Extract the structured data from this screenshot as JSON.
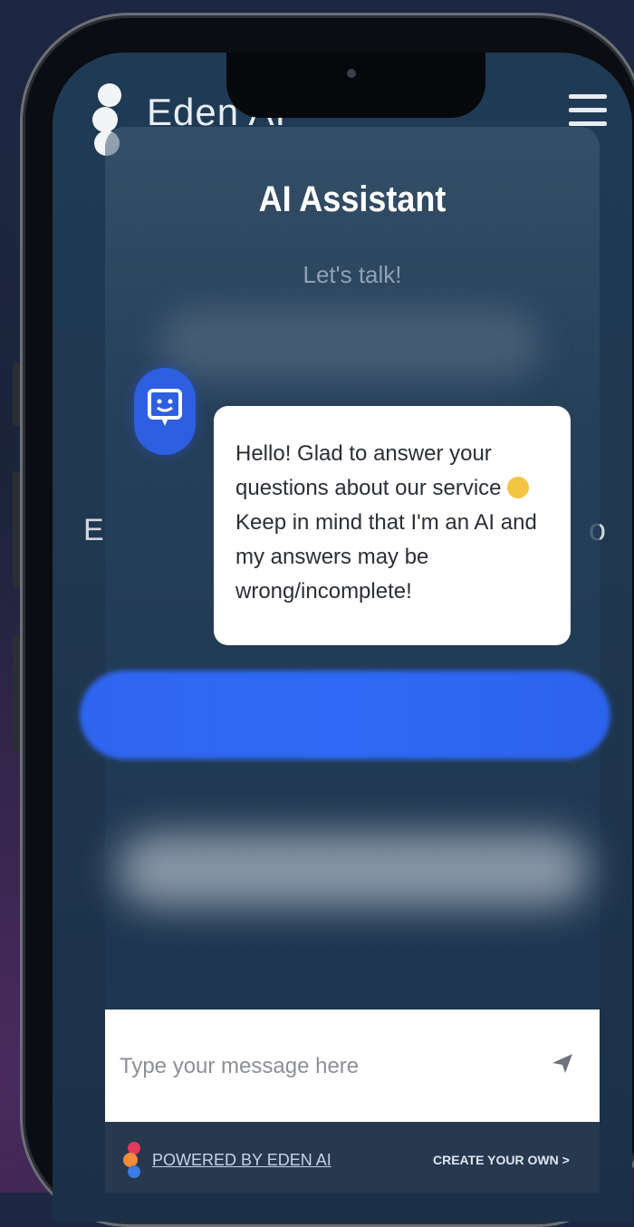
{
  "site": {
    "name": "Eden AI",
    "partial_left": "E",
    "partial_right": "o"
  },
  "chat": {
    "title": "AI Assistant",
    "subtitle": "Let's talk!",
    "bot_message": "Hello! Glad to answer your questions about our service",
    "bot_message_2": "Keep in mind that I'm an AI and my answers may be wrong/incomplete!",
    "input_placeholder": "Type your message here"
  },
  "footer": {
    "powered_by": "POWERED BY EDEN AI",
    "create_own": "CREATE YOUR OWN >"
  },
  "colors": {
    "accent": "#2d5fe0",
    "panel": "#27384f"
  }
}
